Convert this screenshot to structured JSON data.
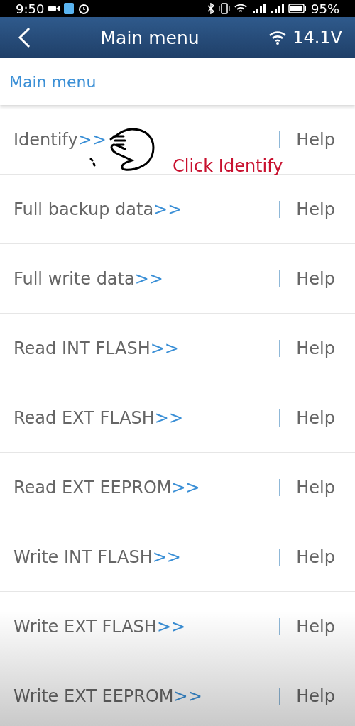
{
  "status_bar": {
    "time": "9:50",
    "battery": "95%"
  },
  "header": {
    "title": "Main menu",
    "voltage": "14.1V"
  },
  "breadcrumb": "Main menu",
  "menu": [
    {
      "label": "Identify",
      "more": ">>",
      "help": "Help"
    },
    {
      "label": "Full backup data",
      "more": ">>",
      "help": "Help"
    },
    {
      "label": "Full write data",
      "more": ">>",
      "help": "Help"
    },
    {
      "label": "Read INT FLASH",
      "more": ">>",
      "help": "Help"
    },
    {
      "label": "Read EXT FLASH",
      "more": ">>",
      "help": "Help"
    },
    {
      "label": "Read EXT EEPROM",
      "more": ">>",
      "help": "Help"
    },
    {
      "label": "Write INT FLASH",
      "more": ">>",
      "help": "Help"
    },
    {
      "label": "Write EXT FLASH",
      "more": ">>",
      "help": "Help"
    },
    {
      "label": "Write EXT EEPROM",
      "more": ">>",
      "help": "Help"
    }
  ],
  "annotation": {
    "text": "Click Identify"
  }
}
